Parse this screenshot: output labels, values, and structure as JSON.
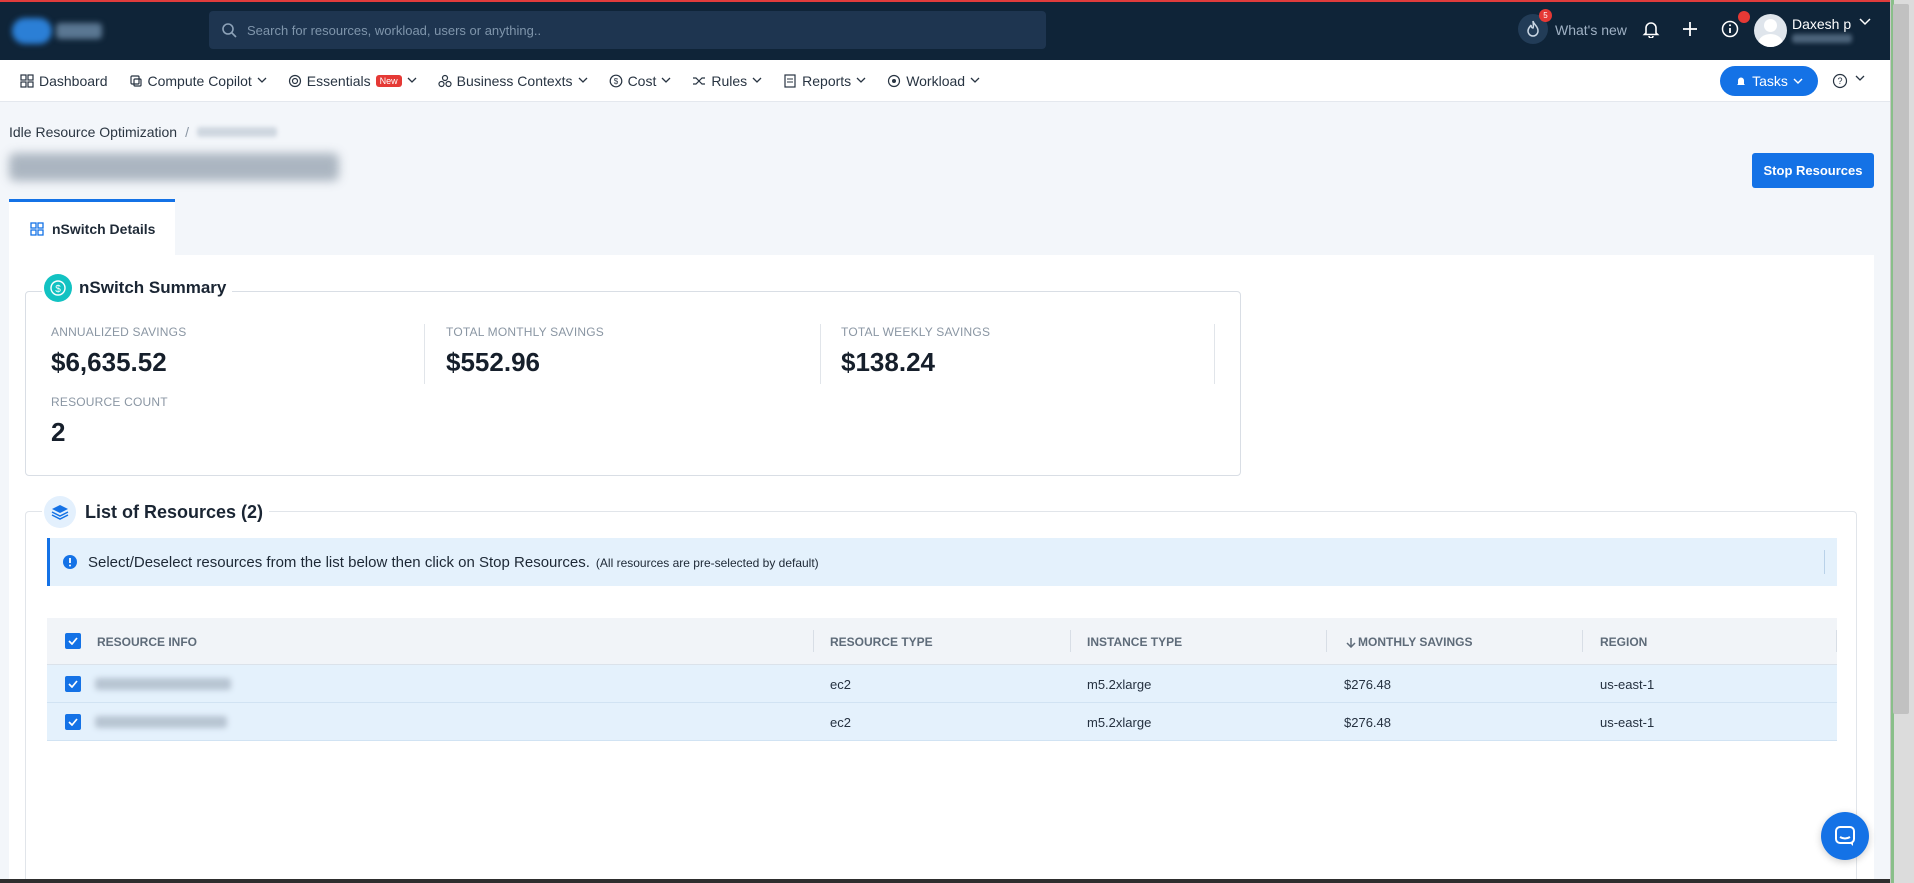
{
  "header": {
    "search_placeholder": "Search for resources, workload, users or anything..",
    "whats_new_label": "What's new",
    "whats_new_count": "5",
    "user_name": "Daxesh p"
  },
  "nav": {
    "items": [
      {
        "label": "Dashboard",
        "icon": "grid-icon"
      },
      {
        "label": "Compute Copilot",
        "icon": "copilot-icon"
      },
      {
        "label": "Essentials",
        "icon": "essentials-icon",
        "badge": "New"
      },
      {
        "label": "Business Contexts",
        "icon": "contexts-icon"
      },
      {
        "label": "Cost",
        "icon": "dollar-icon"
      },
      {
        "label": "Rules",
        "icon": "shuffle-icon"
      },
      {
        "label": "Reports",
        "icon": "report-icon"
      },
      {
        "label": "Workload",
        "icon": "workload-icon"
      }
    ],
    "tasks_label": "Tasks"
  },
  "breadcrumb": {
    "parent": "Idle Resource Optimization",
    "separator": "/"
  },
  "actions": {
    "stop_resources_label": "Stop Resources"
  },
  "tabs": [
    {
      "label": "nSwitch Details"
    }
  ],
  "summary": {
    "title": "nSwitch Summary",
    "metrics": [
      {
        "label": "ANNUALIZED SAVINGS",
        "value": "$6,635.52"
      },
      {
        "label": "TOTAL MONTHLY SAVINGS",
        "value": "$552.96"
      },
      {
        "label": "TOTAL WEEKLY SAVINGS",
        "value": "$138.24"
      },
      {
        "label": "RESOURCE COUNT",
        "value": "2"
      }
    ]
  },
  "resources": {
    "title": "List of Resources (2)",
    "info_text": "Select/Deselect resources from the list below then click on Stop Resources.",
    "info_note": "(All resources are pre-selected by default)",
    "columns": [
      "RESOURCE INFO",
      "RESOURCE TYPE",
      "INSTANCE TYPE",
      "MONTHLY SAVINGS",
      "REGION"
    ],
    "rows": [
      {
        "resource_type": "ec2",
        "instance_type": "m5.2xlarge",
        "monthly_savings": "$276.48",
        "region": "us-east-1"
      },
      {
        "resource_type": "ec2",
        "instance_type": "m5.2xlarge",
        "monthly_savings": "$276.48",
        "region": "us-east-1"
      }
    ]
  },
  "colors": {
    "header_bg": "#0f2438",
    "accent": "#1472e6",
    "summary_icon": "#12c2c2",
    "row_selected": "#e4f1fc"
  }
}
